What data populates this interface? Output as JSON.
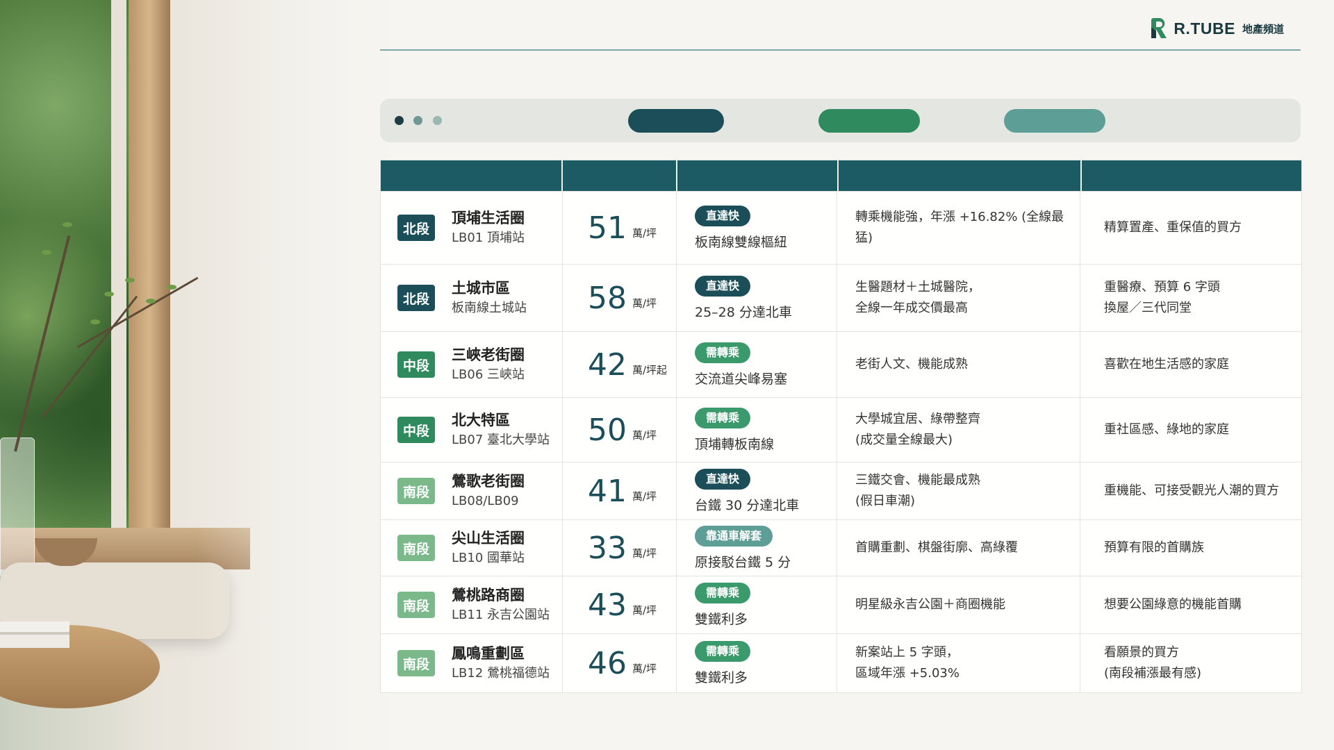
{
  "brand": {
    "name": "R.TUBE",
    "sub": "地產頻道"
  },
  "colors": {
    "header": "#1c5b64",
    "seg_north": "#1b4e58",
    "seg_mid": "#2f8a5e",
    "seg_south": "#7cb98a",
    "tag_express": "#1b4e58",
    "tag_transfer": "#3a9a6c",
    "tag_bus": "#5d9e96"
  },
  "toolbar": {
    "dots": [
      "#1d3c44",
      "#6f9894",
      "#9ab8b2"
    ],
    "pills": [
      "#1b4e58",
      "#2f8a5e",
      "#5d9e96"
    ]
  },
  "rows": [
    {
      "segment": "北段",
      "seg_type": "north",
      "area": "頂埔生活圈",
      "station": "LB01 頂埔站",
      "price": "51",
      "unit": "萬/坪",
      "tag": "直達快",
      "tag_type": "express",
      "transit": "板南線雙線樞紐",
      "feature": "轉乘機能強，年漲 +16.82% (全線最猛)",
      "buyer": "精算置產、重保值的買方"
    },
    {
      "segment": "北段",
      "seg_type": "north",
      "area": "土城市區",
      "station": "板南線土城站",
      "price": "58",
      "unit": "萬/坪",
      "tag": "直達快",
      "tag_type": "express",
      "transit": "25–28 分達北車",
      "feature": "生醫題材＋土城醫院，\n全線一年成交價最高",
      "buyer": "重醫療、預算 6 字頭\n換屋／三代同堂"
    },
    {
      "segment": "中段",
      "seg_type": "mid",
      "area": "三峽老街圈",
      "station": "LB06 三峽站",
      "price": "42",
      "unit": "萬/坪起",
      "tag": "需轉乘",
      "tag_type": "transfer",
      "transit": "交流道尖峰易塞",
      "feature": "老街人文、機能成熟",
      "buyer": "喜歡在地生活感的家庭"
    },
    {
      "segment": "中段",
      "seg_type": "mid",
      "area": "北大特區",
      "station": "LB07 臺北大學站",
      "price": "50",
      "unit": "萬/坪",
      "tag": "需轉乘",
      "tag_type": "transfer",
      "transit": "頂埔轉板南線",
      "feature": "大學城宜居、綠帶整齊\n(成交量全線最大)",
      "buyer": "重社區感、綠地的家庭"
    },
    {
      "segment": "南段",
      "seg_type": "south",
      "area": "鶯歌老街圈",
      "station": "LB08/LB09",
      "price": "41",
      "unit": "萬/坪",
      "tag": "直達快",
      "tag_type": "express",
      "transit": "台鐵 30 分達北車",
      "feature": "三鐵交會、機能最成熟\n(假日車潮)",
      "buyer": "重機能、可接受觀光人潮的買方"
    },
    {
      "segment": "南段",
      "seg_type": "south",
      "area": "尖山生活圈",
      "station": "LB10 國華站",
      "price": "33",
      "unit": "萬/坪",
      "tag": "靠通車解套",
      "tag_type": "bus",
      "transit": "原接駁台鐵 5 分",
      "feature": "首購重劃、棋盤街廓、高綠覆",
      "buyer": "預算有限的首購族"
    },
    {
      "segment": "南段",
      "seg_type": "south",
      "area": "鶯桃路商圈",
      "station": "LB11 永吉公園站",
      "price": "43",
      "unit": "萬/坪",
      "tag": "需轉乘",
      "tag_type": "transfer",
      "transit": "雙鐵利多",
      "feature": "明星級永吉公園＋商圈機能",
      "buyer": "想要公園綠意的機能首購"
    },
    {
      "segment": "南段",
      "seg_type": "south",
      "area": "鳳鳴重劃區",
      "station": "LB12 鶯桃福德站",
      "price": "46",
      "unit": "萬/坪",
      "tag": "需轉乘",
      "tag_type": "transfer",
      "transit": "雙鐵利多",
      "feature": "新案站上 5 字頭，\n區域年漲 +5.03%",
      "buyer": "看願景的買方\n(南段補漲最有感)"
    }
  ]
}
